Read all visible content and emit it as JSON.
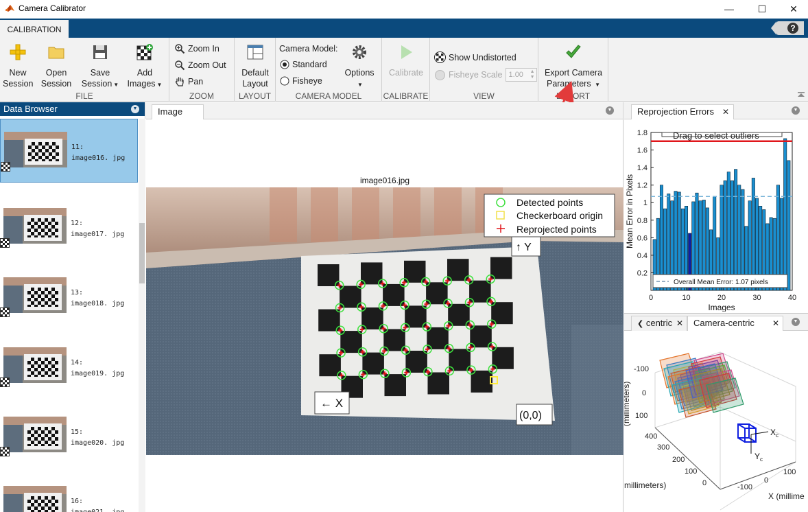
{
  "window": {
    "title": "Camera Calibrator",
    "controls": [
      "—",
      "☐",
      "✕"
    ]
  },
  "ribbon": {
    "tab_label": "CALIBRATION",
    "help_label": "?"
  },
  "toolstrip": {
    "file": {
      "title": "FILE",
      "new_session": "New\nSession",
      "open_session": "Open\nSession",
      "save_session": "Save\nSession",
      "add_images": "Add\nImages"
    },
    "zoom": {
      "title": "ZOOM",
      "zoom_in": "Zoom In",
      "zoom_out": "Zoom Out",
      "pan": "Pan"
    },
    "layout": {
      "title": "LAYOUT",
      "default_layout": "Default\nLayout"
    },
    "camera_model": {
      "title": "CAMERA MODEL",
      "label": "Camera Model:",
      "standard": "Standard",
      "fisheye": "Fisheye",
      "options": "Options",
      "selected": "Standard"
    },
    "calibrate": {
      "title": "CALIBRATE",
      "calibrate": "Calibrate"
    },
    "view": {
      "title": "VIEW",
      "show_undistorted": "Show Undistorted",
      "fisheye_scale": "Fisheye Scale",
      "fisheye_value": "1.00"
    },
    "export": {
      "title": "EXPORT",
      "export_params": "Export Camera\nParameters"
    }
  },
  "browser": {
    "title": "Data Browser",
    "items": [
      {
        "index": "11:",
        "name": "image016. jpg",
        "selected": true
      },
      {
        "index": "12:",
        "name": "image017. jpg",
        "selected": false
      },
      {
        "index": "13:",
        "name": "image018. jpg",
        "selected": false
      },
      {
        "index": "14:",
        "name": "image019. jpg",
        "selected": false
      },
      {
        "index": "15:",
        "name": "image020. jpg",
        "selected": false
      },
      {
        "index": "16:",
        "name": "image021. jpg",
        "selected": false
      }
    ]
  },
  "image_panel": {
    "tab": "Image",
    "image_title": "image016.jpg",
    "legend": [
      "Detected points",
      "Checkerboard origin",
      "Reprojected points"
    ],
    "axis_labels": {
      "y": "↑ Y",
      "x": "← X",
      "origin": "(0,0)"
    }
  },
  "reprojection": {
    "tab": "Reprojection Errors",
    "drag_label": "Drag to select outliers",
    "mean_label": "Overall Mean Error: 1.07 pixels",
    "colors": {
      "bar": "#1a8fd0",
      "selected_bar": "#0c1fa8",
      "threshold": "#e0161b",
      "mean_line": "#78b4d8"
    }
  },
  "chart_data": {
    "type": "bar",
    "title": "",
    "xlabel": "Images",
    "ylabel": "Mean Error in Pixels",
    "xlim": [
      0,
      40
    ],
    "ylim": [
      0,
      1.8
    ],
    "xticks": [
      0,
      10,
      20,
      30,
      40
    ],
    "yticks": [
      0.2,
      0.4,
      0.6,
      0.8,
      1,
      1.2,
      1.4,
      1.6,
      1.8
    ],
    "categories": [
      1,
      2,
      3,
      4,
      5,
      6,
      7,
      8,
      9,
      10,
      11,
      12,
      13,
      14,
      15,
      16,
      17,
      18,
      19,
      20,
      21,
      22,
      23,
      24,
      25,
      26,
      27,
      28,
      29,
      30,
      31,
      32,
      33,
      34,
      35,
      36,
      37,
      38,
      39
    ],
    "values": [
      0.58,
      0.82,
      1.2,
      0.93,
      1.1,
      1.02,
      1.13,
      1.12,
      0.93,
      0.96,
      0.65,
      1.01,
      1.11,
      1.02,
      1.03,
      0.94,
      0.69,
      1.07,
      0.6,
      1.2,
      1.25,
      1.35,
      1.25,
      1.38,
      1.2,
      1.15,
      0.73,
      1.02,
      1.28,
      1.05,
      0.96,
      0.92,
      0.76,
      0.83,
      0.82,
      1.2,
      1.05,
      1.73,
      1.48
    ],
    "selected_index": 11,
    "mean_error": 1.07,
    "threshold": 1.7
  },
  "camera_panel": {
    "tabs": [
      "centric",
      "Camera-centric"
    ],
    "z_ticks": [
      "-100",
      "0",
      "100"
    ],
    "y_ticks": [
      "400",
      "300",
      "200",
      "100",
      "0"
    ],
    "x_ticks": [
      "100",
      "0",
      "-100"
    ],
    "z_label": "(millimeters)",
    "y_label": "(millimeters)",
    "x_label": "X (millime",
    "axes": {
      "xc": "X",
      "yc": "Y",
      "sub": "c"
    }
  }
}
